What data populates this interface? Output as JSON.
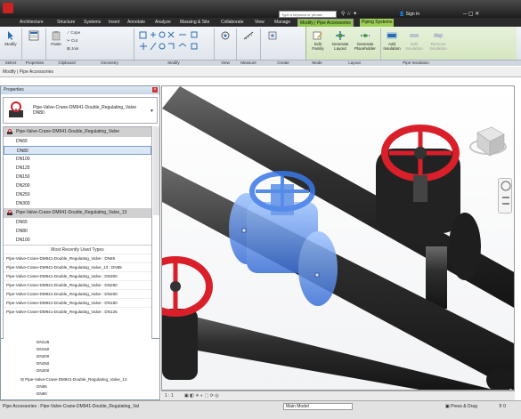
{
  "titlebar": {
    "search_placeholder": "Type a keyword or phrase",
    "sign_in": "Sign In"
  },
  "tabs": [
    "Architecture",
    "Structure",
    "Systems",
    "Insert",
    "Annotate",
    "Analyze",
    "Massing & Site",
    "Collaborate",
    "View",
    "Manage",
    "Modify | Pipe Accessories",
    "Piping Systems"
  ],
  "ribbon": {
    "modify_label": "Modify",
    "panels": [
      "Select",
      "Properties",
      "Clipboard",
      "Geometry",
      "Modify",
      "View",
      "Measure",
      "Create",
      "Mode",
      "Layout",
      "Pipe Insulation"
    ],
    "clipboard": {
      "paste": "Paste",
      "cope": "Cope",
      "cut": "Cut",
      "join": "Join"
    },
    "mode_edit_family": [
      "Edit",
      "Family"
    ],
    "layout_generate_layout": [
      "Generate",
      "Layout"
    ],
    "layout_generate_placeholder": [
      "Generate",
      "Placeholder"
    ],
    "insulation_add": [
      "Add",
      "Insulation"
    ],
    "insulation_edit": [
      "Edit",
      "Insulation"
    ],
    "insulation_remove": [
      "Remove",
      "Insulation"
    ]
  },
  "optbar": {
    "label": "Modify | Pipe Accessories"
  },
  "properties": {
    "title": "Properties",
    "selected_type": "Pipe-Valve-Crane-DM941-Double_Regulating_Valve DN80",
    "family1": "Pipe-Valve-Crane-DM941-Double_Regulating_Valve",
    "family1_types": [
      "DN65",
      "DN80",
      "DN100",
      "DN125",
      "DN150",
      "DN200",
      "DN250",
      "DN300"
    ],
    "selected_index": 1,
    "family2": "Pipe-Valve-Crane-DM941-Double_Regulating_Valve_13",
    "family2_types": [
      "DN65",
      "DN80",
      "DN100"
    ],
    "mru_title": "Most Recently Used Types",
    "mru_items": [
      "Pipe-Valve-Crane-DM941-Double_Regulating_Valve : DN65",
      "Pipe-Valve-Crane-DM941-Double_Regulating_Valve_13 : DN65",
      "Pipe-Valve-Crane-DM941-Double_Regulating_Valve : DN300",
      "Pipe-Valve-Crane-DM941-Double_Regulating_Valve : DN250",
      "Pipe-Valve-Crane-DM941-Double_Regulating_Valve : DN200",
      "Pipe-Valve-Crane-DM941-Double_Regulating_Valve : DN150",
      "Pipe-Valve-Crane-DM941-Double_Regulating_Valve : DN125"
    ]
  },
  "browser": {
    "items": [
      "DN125",
      "DN150",
      "DN200",
      "DN250",
      "DN300"
    ],
    "family": "Pipe-Valve-Crane-DM941-Double_Regulating_Valve_13",
    "sub": "DN65",
    "sub2": "DN80"
  },
  "viewctl": {
    "scale": "1 : 1"
  },
  "status": {
    "text": "Pipe Accessories : Pipe-Valve-Crane-DM941-Double_Regulating_Val",
    "model": "Main Model",
    "press_drag": "Press & Drag",
    "filter": "0"
  },
  "colors": {
    "valve_red": "#d9202a",
    "selected_blue": "#3b78e7",
    "pipe_dark": "#2d2d2d",
    "ribbon_green": "#8fc44a"
  }
}
